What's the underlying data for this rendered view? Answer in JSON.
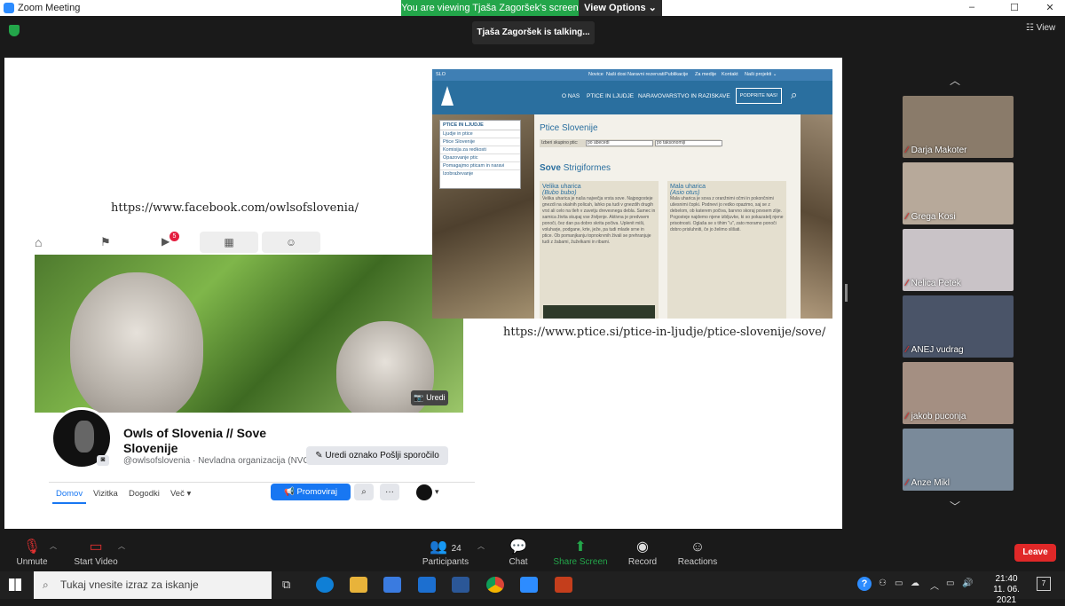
{
  "window": {
    "title": "Zoom Meeting",
    "min": "–",
    "max": "☐",
    "close": "✕"
  },
  "banner": {
    "viewing": "You are viewing Tjaša Zagoršek's screen",
    "view_options": "View Options ⌄"
  },
  "talking": "Tjaša Zagoršek is talking...",
  "view_button": "☷ View",
  "facebook": {
    "url": "https://www.facebook.com/owlsofslovenia/",
    "notif_badge": "5",
    "edit_cover": "📷 Uredi",
    "page_name": "Owls of Slovenia // Sove Slovenije",
    "handle": "@owlsofslovenia · Nevladna organizacija (NVO)",
    "edit_button": "✎ Uredi oznako Pošlji sporočilo",
    "tabs": [
      "Domov",
      "Vizitka",
      "Dogodki",
      "Več ▾"
    ],
    "promote": "📢 Promoviraj"
  },
  "ptice": {
    "url": "https://www.ptice.si/ptice-in-ljudje/ptice-slovenije/sove/",
    "lang": "SLO",
    "top_links": [
      "Novice",
      "Naši dosi",
      "Naravni rezervati",
      "Publikacije",
      "Za medije",
      "Kontakt",
      "Naši projekti ⌄"
    ],
    "nav": [
      "O NAS",
      "PTICE IN LJUDJE",
      "NARAVOVARSTVO IN RAZISKAVE"
    ],
    "support": "PODPRITE NAS!",
    "menu_title": "PTICE IN LJUDJE",
    "menu_items": [
      "Ljudje in ptice",
      "Ptice Slovenije",
      "Komisija za redkosti",
      "Opazovanje ptic",
      "Pomagajmo pticam in naravi",
      "Izobraževanje"
    ],
    "page_title": "Ptice Slovenije",
    "filter_label": "Izberi skupino ptic:",
    "filter_a": "po abecedi",
    "filter_b": "po taksonomiji",
    "section_bold": "Sove",
    "section_rest": "Strigiformes",
    "species": [
      {
        "name": "Velika uharica",
        "latin": "(Bubo bubo)",
        "text": "Velika uharica je naša največja vrsta sove. Najpogosteje gnezdi na skalnih policah, lahko pa tudi v gnezdih drugih vrst ali celo na tleh v zavetju drevesnega debla. Samec in samica živita skupaj vse življenje. Aktivna je predvsem ponoči, čez dan pa dobro skrita počiva. Uplenit miši, voluharje, podgane, krte, ježe, pa tudi mlade srne in ptice. Ob pomanjkanju topnokrvnih živali se prehranjuje tudi z žabami, žuželkami in ribami."
      },
      {
        "name": "Mala uharica",
        "latin": "(Asio otus)",
        "text": "Mala uharica je sova z oranžnimi očmi in pokončnimi ušesnimi čopki. Podnevi jo redko opazimo, saj se z debelom, ob katerem počiva, barvno skoraj povsem zlije. Pogosteje najdemo njene izbljuvke, ki so pokazatelj njene prisotnosti. Oglaša se s tihim \"u\", zato moramo ponoči dobro prisluhniti, če jo želimo slišati."
      }
    ]
  },
  "participants": [
    {
      "name": "Darja Makoter",
      "bg": "#8a7b6a"
    },
    {
      "name": "Grega Kosi",
      "bg": "#b7a99a"
    },
    {
      "name": "Nelica Petek",
      "bg": "#c9c3c7"
    },
    {
      "name": "ANEJ vudrag",
      "bg": "#4a5468"
    },
    {
      "name": "jakob puconja",
      "bg": "#a48f82"
    },
    {
      "name": "Anze Mikl",
      "bg": "#7a8a9a"
    }
  ],
  "toolbar": {
    "unmute": "Unmute",
    "start_video": "Start Video",
    "participants": "Participants",
    "participants_count": "24",
    "chat": "Chat",
    "share": "Share Screen",
    "record": "Record",
    "reactions": "Reactions",
    "leave": "Leave"
  },
  "taskbar": {
    "search_placeholder": "Tukaj vnesite izraz za iskanje",
    "time": "21:40",
    "date": "11. 06. 2021",
    "notif": "7"
  },
  "colors": {
    "zoom_blue": "#2d8cff",
    "green": "#23a64a",
    "leave_red": "#e02828",
    "fb_blue": "#1877f2"
  }
}
